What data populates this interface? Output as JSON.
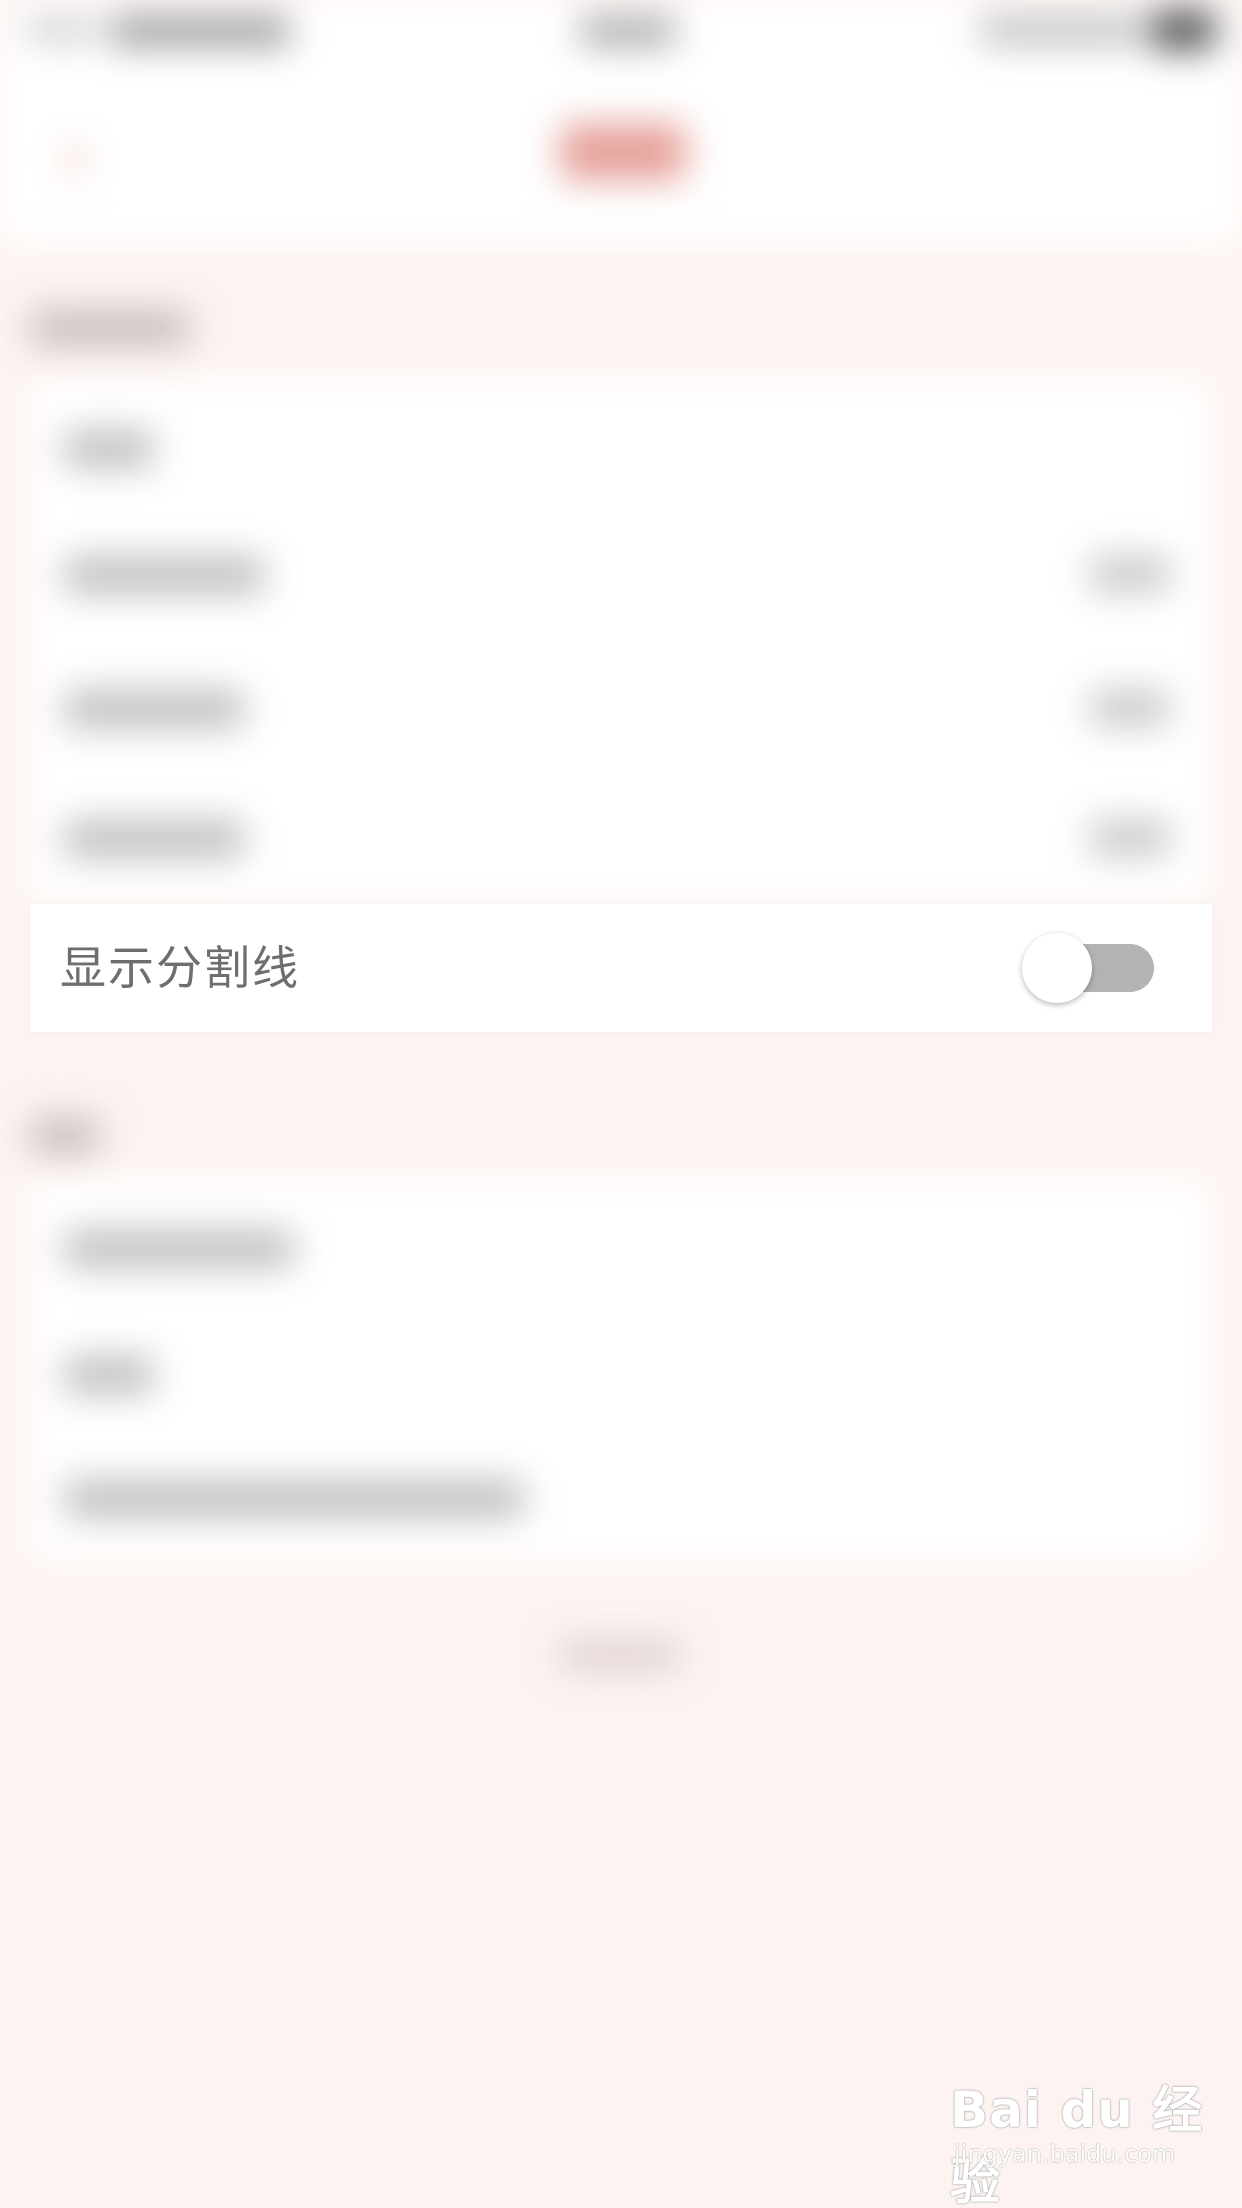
{
  "settings": {
    "show_divider_label": "显示分割线",
    "show_divider_enabled": false
  },
  "colors": {
    "page_background": "#fdf4f2",
    "accent": "#e07a70",
    "switch_off_track": "#b3b3b3",
    "label_text": "#6e6e6e"
  },
  "watermark": {
    "brand": "Bai du 经验",
    "url": "jingyan.baidu.com"
  }
}
